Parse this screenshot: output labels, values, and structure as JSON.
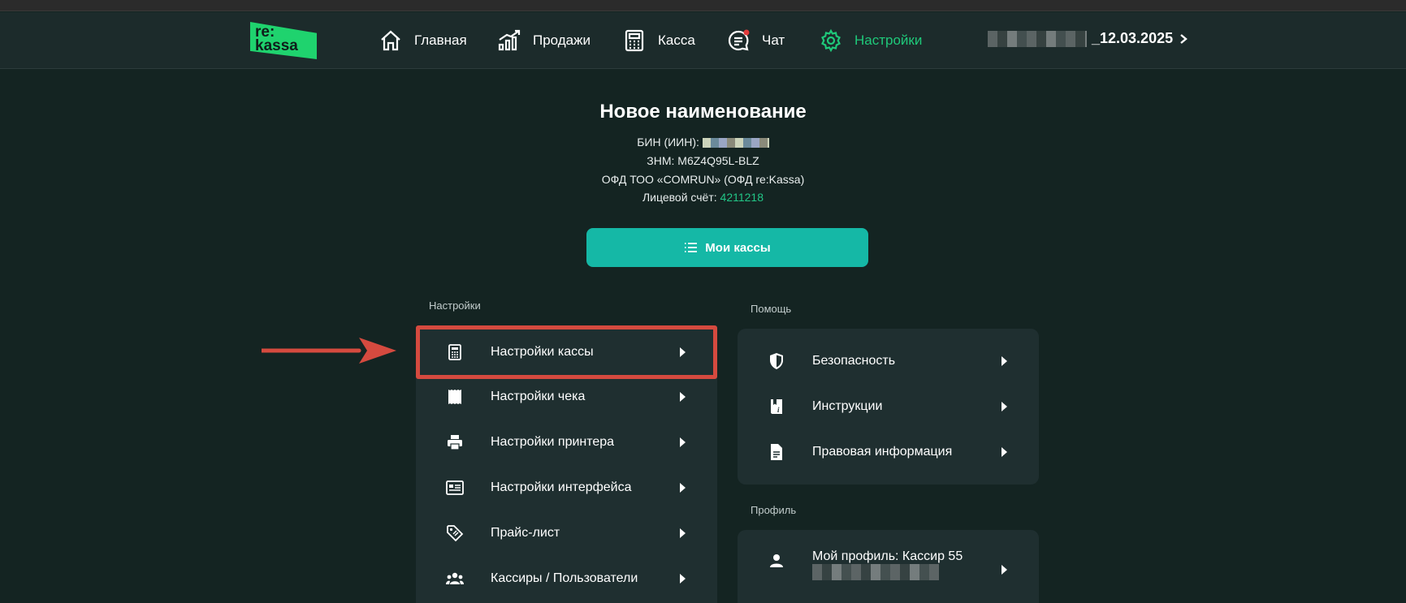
{
  "brand": {
    "logo_line1": "re:",
    "logo_line2": "kassa",
    "accent": "#1fd36e"
  },
  "nav": {
    "items": [
      {
        "label": "Главная",
        "icon": "home-icon"
      },
      {
        "label": "Продажи",
        "icon": "chart-icon"
      },
      {
        "label": "Касса",
        "icon": "calculator-icon"
      },
      {
        "label": "Чат",
        "icon": "chat-icon"
      },
      {
        "label": "Настройки",
        "icon": "gear-icon"
      }
    ],
    "active": "Настройки",
    "date_suffix": "_12.03.2025"
  },
  "header": {
    "title": "Новое наименование",
    "bin_label": "БИН (ИИН):",
    "znm": "ЗНМ: M6Z4Q95L-BLZ",
    "ofd": "ОФД ТОО «COMRUN» (ОФД re:Kassa)",
    "account_label": "Лицевой счёт:",
    "account_number": "4211218"
  },
  "my_kassas_button": {
    "label": "Мои кассы",
    "icon": "list-icon"
  },
  "settings": {
    "section_label": "Настройки",
    "items": [
      {
        "label": "Настройки кассы",
        "icon": "calculator-icon"
      },
      {
        "label": "Настройки чека",
        "icon": "receipt-icon"
      },
      {
        "label": "Настройки принтера",
        "icon": "printer-icon"
      },
      {
        "label": "Настройки интерфейса",
        "icon": "interface-icon"
      },
      {
        "label": "Прайс-лист",
        "icon": "price-tag-icon"
      },
      {
        "label": "Кассиры / Пользователи",
        "icon": "users-icon"
      }
    ]
  },
  "help": {
    "section_label": "Помощь",
    "items": [
      {
        "label": "Безопасность",
        "icon": "shield-icon"
      },
      {
        "label": "Инструкции",
        "icon": "book-icon"
      },
      {
        "label": "Правовая информация",
        "icon": "document-icon"
      }
    ]
  },
  "profile": {
    "section_label": "Профиль",
    "label": "Мой профиль: Кассир 55",
    "icon": "user-icon"
  },
  "colors": {
    "background": "#142422",
    "panel": "#1f2f30",
    "button": "#15b8a6",
    "highlight": "#d54a3f"
  }
}
